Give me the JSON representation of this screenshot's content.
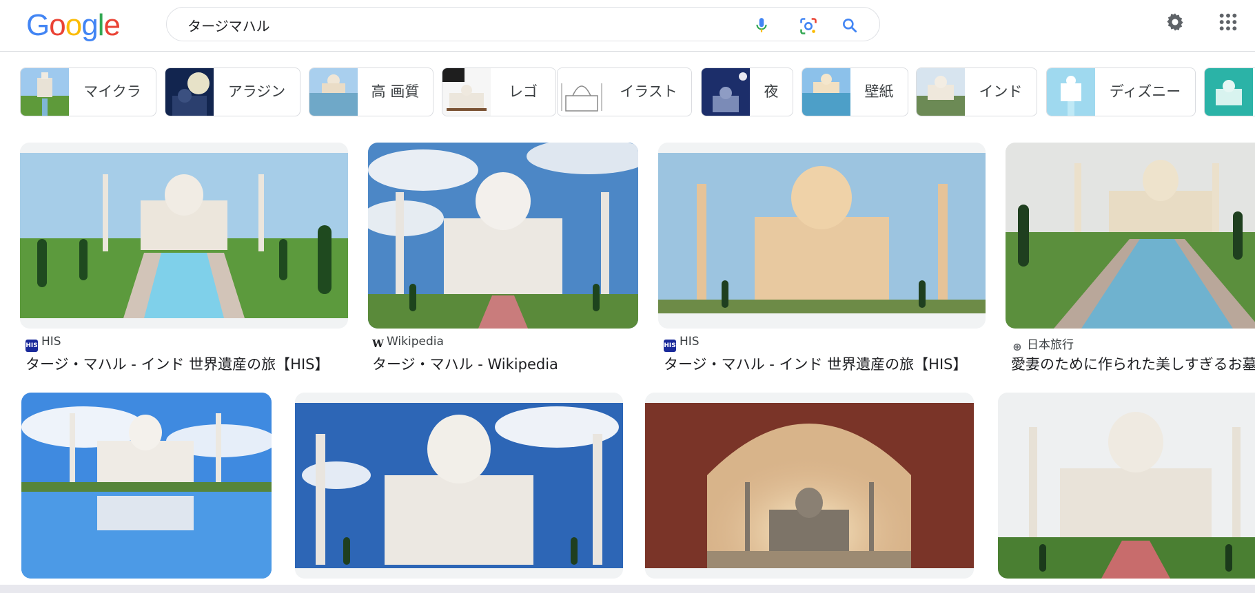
{
  "logo": {
    "letters": [
      "G",
      "o",
      "o",
      "g",
      "l",
      "e"
    ]
  },
  "search": {
    "query": "タージマハル"
  },
  "chips": [
    {
      "label": "マイクラ"
    },
    {
      "label": "アラジン"
    },
    {
      "label": "高 画質"
    },
    {
      "label": "レゴ"
    },
    {
      "label": "イラスト"
    },
    {
      "label": "夜"
    },
    {
      "label": "壁紙"
    },
    {
      "label": "インド"
    },
    {
      "label": "ディズニー"
    }
  ],
  "results": [
    {
      "source": "HIS",
      "favicon": "his-logo",
      "title": "タージ・マハル - インド 世界遺産の旅【HIS】"
    },
    {
      "source": "Wikipedia",
      "favicon": "wikipedia-w",
      "title": "タージ・マハル - Wikipedia"
    },
    {
      "source": "HIS",
      "favicon": "his-logo",
      "title": "タージ・マハル - インド 世界遺産の旅【HIS】"
    },
    {
      "source": "日本旅行",
      "favicon": "globe-icon",
      "title": "愛妻のために作られた美しすぎるお墓"
    }
  ],
  "favicon_text": {
    "his": "HIS",
    "w": "W",
    "globe": "⊕"
  },
  "colors": {
    "google_blue": "#4285F4",
    "google_red": "#EA4335",
    "google_yellow": "#FBBC05",
    "google_green": "#34A853"
  }
}
